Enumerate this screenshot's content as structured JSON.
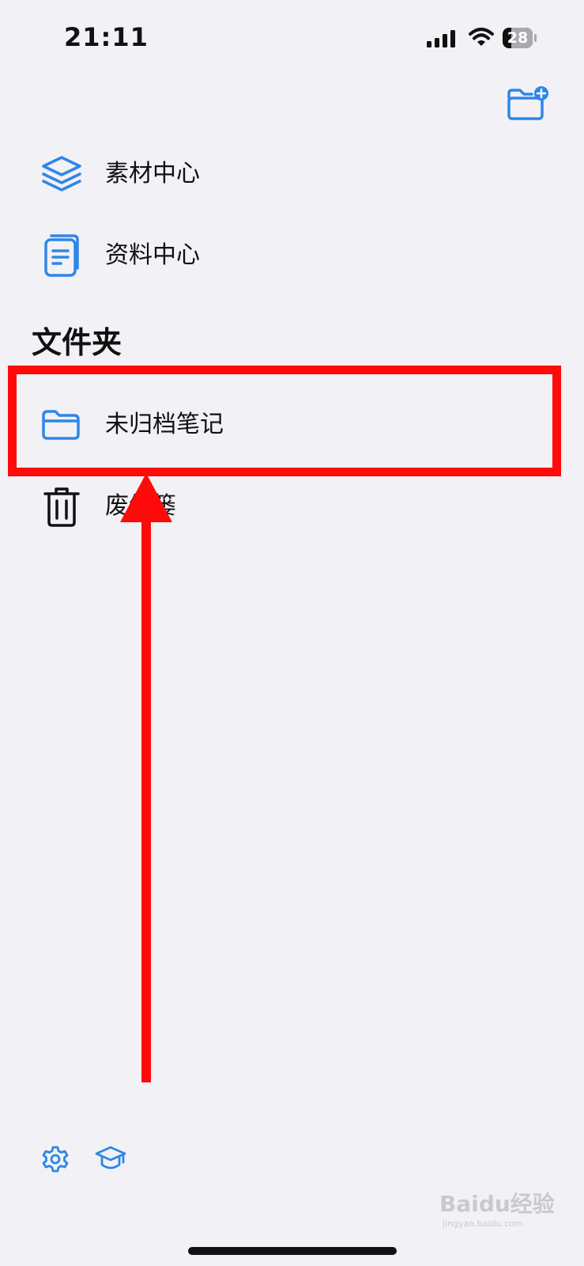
{
  "status_bar": {
    "time": "21:11",
    "battery_level": "28"
  },
  "nav_items": [
    {
      "label": "素材中心",
      "icon": "stack-layers-icon"
    },
    {
      "label": "资料中心",
      "icon": "document-icon"
    }
  ],
  "folders_section": {
    "title": "文件夹",
    "items": [
      {
        "label": "未归档笔记",
        "icon": "folder-icon"
      },
      {
        "label": "废纸篓",
        "icon": "trash-icon"
      }
    ]
  },
  "toolbar": {
    "new_folder_icon": "folder-add-icon",
    "settings_icon": "gear-icon",
    "learn_icon": "graduation-cap-icon"
  },
  "annotation": {
    "highlight_color": "#FF0A0A"
  },
  "watermark": {
    "text": "Baidu经验",
    "sub": "jingyan.baidu.com"
  },
  "colors": {
    "accent": "#2F86E8",
    "background": "#F1F1F6"
  }
}
